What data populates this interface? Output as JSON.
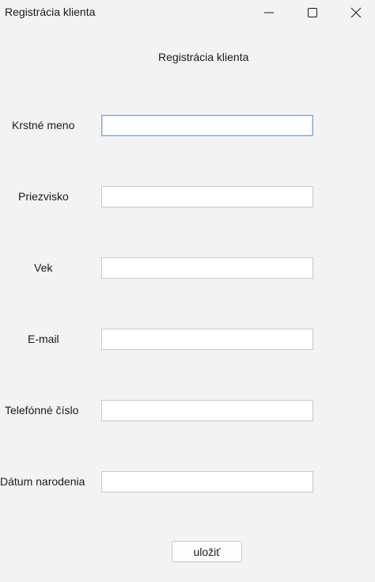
{
  "window": {
    "title": "Registrácia klienta"
  },
  "form": {
    "heading": "Registrácia  klienta",
    "fields": [
      {
        "label": "Krstné meno",
        "value": "",
        "focused": true
      },
      {
        "label": "Priezvisko",
        "value": ""
      },
      {
        "label": "Vek",
        "value": ""
      },
      {
        "label": "E-mail",
        "value": ""
      },
      {
        "label": "Telefónné číslo",
        "value": ""
      },
      {
        "label": "Dátum narodenia",
        "value": ""
      }
    ],
    "save_label": "uložiť"
  },
  "icons": {
    "minimize": "minimize-icon",
    "maximize": "maximize-icon",
    "close": "close-icon"
  },
  "colors": {
    "background": "#f3f3f3",
    "focus_border": "#7aa7d6"
  }
}
